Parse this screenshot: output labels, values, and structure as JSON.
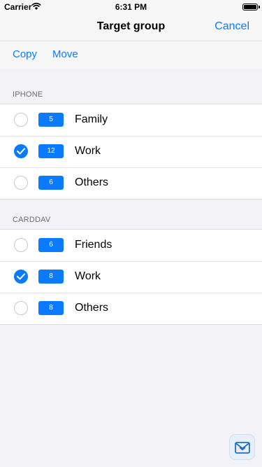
{
  "status_bar": {
    "carrier": "Carrier",
    "time": "6:31 PM",
    "wifi_icon": "wifi-icon",
    "battery_icon": "battery-icon"
  },
  "nav": {
    "title": "Target group",
    "cancel_label": "Cancel"
  },
  "toolbar": {
    "copy_label": "Copy",
    "move_label": "Move"
  },
  "sections": [
    {
      "header": "IPHONE",
      "rows": [
        {
          "count": "5",
          "label": "Family",
          "checked": false
        },
        {
          "count": "12",
          "label": "Work",
          "checked": true
        },
        {
          "count": "6",
          "label": "Others",
          "checked": false
        }
      ]
    },
    {
      "header": "CARDDAV",
      "rows": [
        {
          "count": "6",
          "label": "Friends",
          "checked": false
        },
        {
          "count": "8",
          "label": "Work",
          "checked": true
        },
        {
          "count": "8",
          "label": "Others",
          "checked": false
        }
      ]
    }
  ],
  "colors": {
    "accent": "#0a7aff",
    "background": "#f2f2f7",
    "section_header": "#6d6d72"
  },
  "app_icon": "mail-app-icon"
}
